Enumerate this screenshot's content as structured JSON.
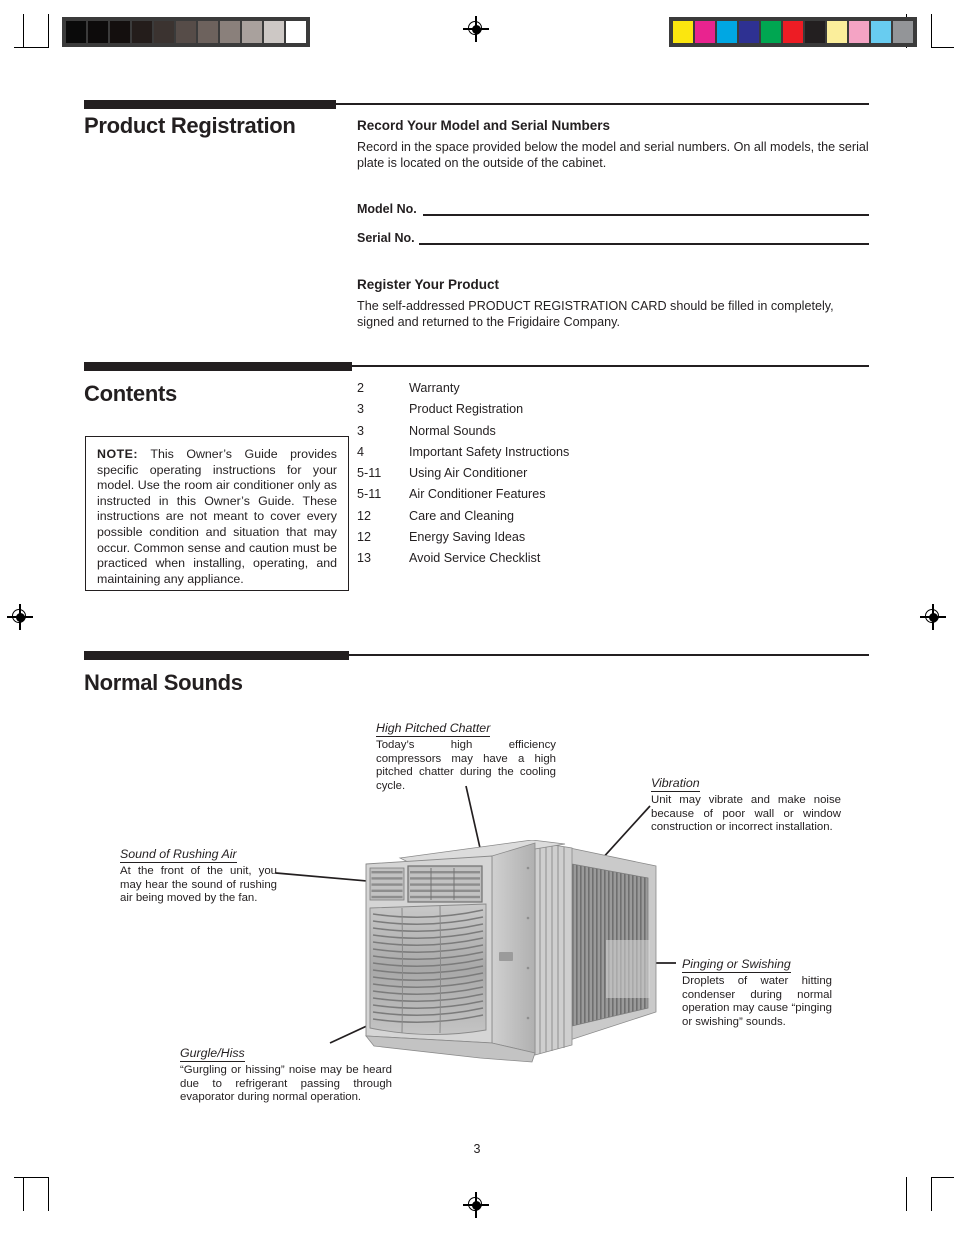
{
  "printer_marks": {
    "grayscale_patches": [
      "#0a0a0a",
      "#0d0b0b",
      "#140f0e",
      "#241d1b",
      "#3b3330",
      "#564c48",
      "#6d625d",
      "#8a807b",
      "#a9a19d",
      "#cdc8c5",
      "#ffffff"
    ],
    "color_patches": [
      "#fbe60f",
      "#e9238f",
      "#00a7e3",
      "#2e3192",
      "#00a651",
      "#ed1c24",
      "#231f20",
      "#fbee9b",
      "#f4a3c4",
      "#68ccf0",
      "#939598"
    ],
    "registration_mark": "registration-target"
  },
  "product_registration": {
    "section_title": "Product Registration",
    "record_heading": "Record Your Model and Serial Numbers",
    "record_body": "Record in the space provided below the model and serial numbers. On all models, the serial plate is located on the outside of the cabinet.",
    "model_label": "Model No.",
    "serial_label": "Serial No.",
    "register_heading": "Register Your Product",
    "register_body": "The self-addressed PRODUCT REGISTRATION CARD should be filled in completely, signed and returned to the Frigidaire Company."
  },
  "contents": {
    "section_title": "Contents",
    "entries": [
      {
        "page": "2",
        "label": "Warranty"
      },
      {
        "page": "3",
        "label": "Product Registration"
      },
      {
        "page": "3",
        "label": "Normal Sounds"
      },
      {
        "page": "4",
        "label": "Important Safety Instructions"
      },
      {
        "page": "5-11",
        "label": "Using Air Conditioner"
      },
      {
        "page": "5-11",
        "label": "Air Conditioner Features"
      },
      {
        "page": "12",
        "label": "Care and Cleaning"
      },
      {
        "page": "12",
        "label": "Energy Saving Ideas"
      },
      {
        "page": "13",
        "label": "Avoid Service Checklist"
      }
    ],
    "note_label": "NOTE:",
    "note_text": " This Owner’s Guide provides specific operating instructions for your model. Use the room air conditioner only as instructed in this Owner’s Guide. These instructions are not meant to cover every possible condition and situation that may occur. Common sense and caution must be practiced when installing, operating, and maintaining any appliance."
  },
  "normal_sounds": {
    "section_title": "Normal Sounds",
    "callouts": [
      {
        "id": "high-pitched-chatter",
        "title": "High Pitched Chatter",
        "body": "Today’s high efficiency compressors may have a high pitched chatter during the cooling cycle."
      },
      {
        "id": "vibration",
        "title": "Vibration",
        "body": "Unit may vibrate and make noise because of poor wall or window construction or incorrect installation."
      },
      {
        "id": "sound-of-rushing-air",
        "title": "Sound of Rushing Air",
        "body": "At the front of the unit, you may hear the sound of rushing air being moved by the fan."
      },
      {
        "id": "pinging-or-swishing",
        "title": "Pinging or Swishing",
        "body": "Droplets of water hitting condenser during normal operation may cause “pinging or swishing” sounds."
      },
      {
        "id": "gurgle-hiss",
        "title": "Gurgle/Hiss",
        "body": " “Gurgling or hissing” noise may be heard due to refrigerant passing through evaporator during normal operation."
      }
    ],
    "illustration_alt": "window-air-conditioner-unit"
  },
  "footer": {
    "page_number": "3"
  }
}
